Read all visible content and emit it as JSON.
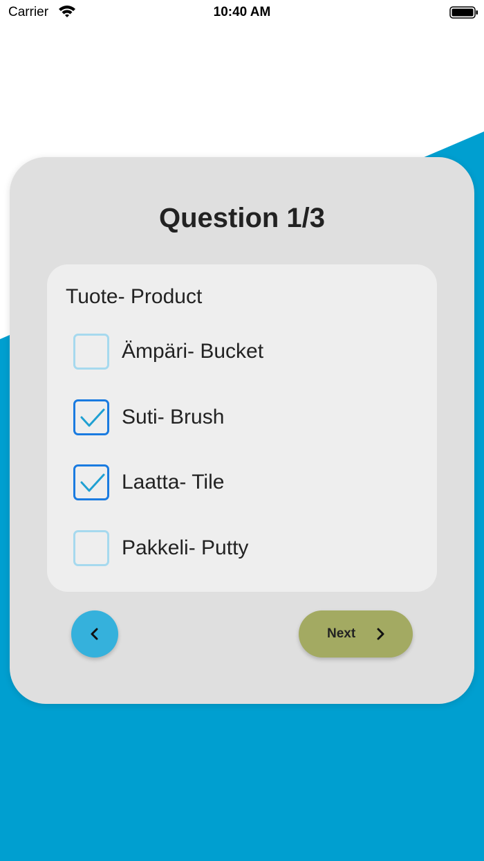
{
  "status_bar": {
    "carrier": "Carrier",
    "time": "10:40 AM"
  },
  "quiz": {
    "title": "Question 1/3",
    "category": "Tuote- Product",
    "options": [
      {
        "label": "Ämpäri- Bucket",
        "checked": false
      },
      {
        "label": "Suti- Brush",
        "checked": true
      },
      {
        "label": "Laatta- Tile",
        "checked": true
      },
      {
        "label": "Pakkeli- Putty",
        "checked": false
      }
    ],
    "back_icon": "chevron-left-icon",
    "next_label": "Next",
    "next_icon": "chevron-right-icon"
  },
  "colors": {
    "background_accent": "#009fd0",
    "card": "#dfdfdf",
    "panel": "#eeeeee",
    "back_button": "#35b1dc",
    "next_button": "#a3aa62",
    "checkbox_checked_border": "#1a7be0",
    "checkbox_unchecked_border": "#a6d9ee",
    "checkmark": "#1fa0d2"
  }
}
